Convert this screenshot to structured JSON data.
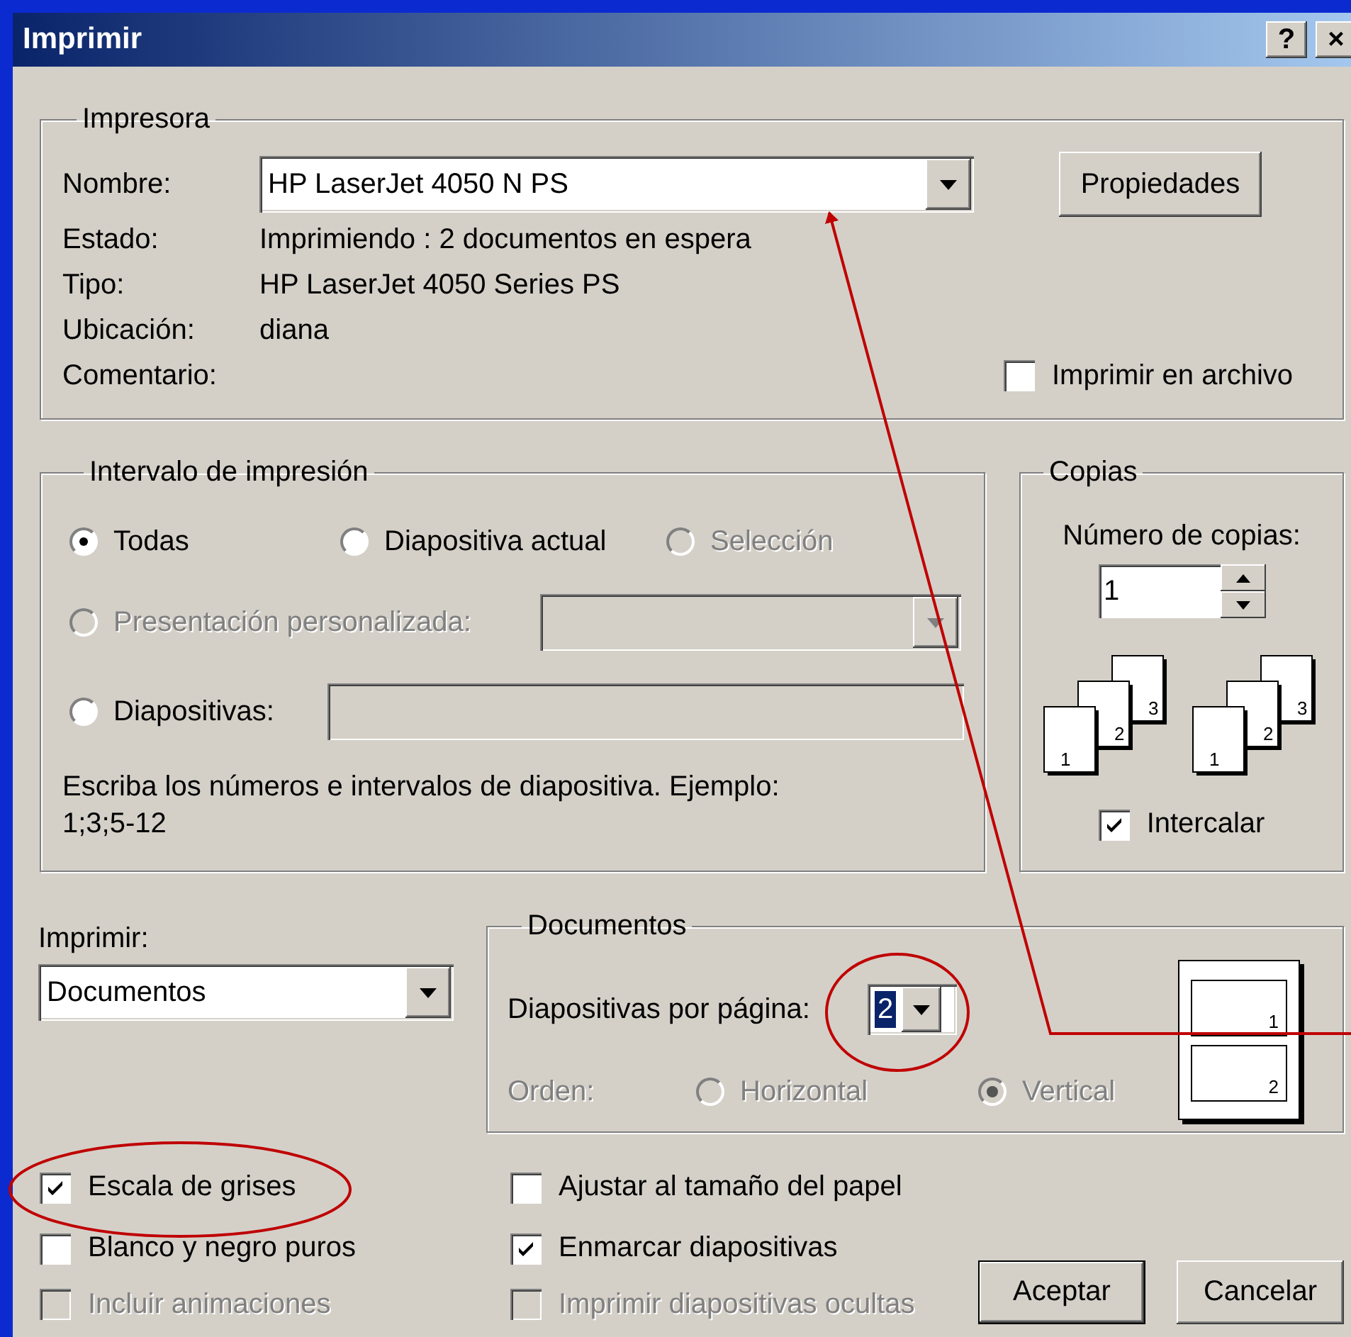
{
  "window": {
    "title": "Imprimir",
    "buttons": [
      "?",
      "×"
    ]
  },
  "printer": {
    "legend": "Impresora",
    "name_label": "Nombre:",
    "name": "HP LaserJet 4050 N PS",
    "properties_button": "Propiedades",
    "info": [
      {
        "label": "Estado:",
        "value": "Imprimiendo : 2 documentos en espera"
      },
      {
        "label": "Tipo:",
        "value": "HP LaserJet 4050 Series PS"
      },
      {
        "label": "Ubicación:",
        "value": "diana"
      },
      {
        "label": "Comentario:"
      }
    ],
    "print_to_file": {
      "label": "Imprimir en archivo",
      "checked": false
    }
  },
  "range": {
    "legend": "Intervalo de impresión",
    "options": [
      {
        "label": "Todas",
        "selected": true,
        "disabled": false
      },
      {
        "label": "Diapositiva actual",
        "selected": false,
        "disabled": false
      },
      {
        "label": "Selección",
        "selected": false,
        "disabled": true
      },
      {
        "label": "Presentación personalizada:",
        "selected": false,
        "disabled": true
      },
      {
        "label": "Diapositivas:",
        "selected": false,
        "disabled": false
      }
    ],
    "hint": "Escriba los números e intervalos de diapositiva. Ejemplo: 1;3;5-12"
  },
  "copies": {
    "legend": "Copias",
    "count_label": "Número de copias:",
    "count": "1",
    "stacks": [
      [
        "1",
        "2",
        "3"
      ],
      [
        "1",
        "2",
        "3"
      ]
    ],
    "collate": {
      "label": "Intercalar",
      "checked": true
    }
  },
  "print_what": {
    "label": "Imprimir:",
    "value": "Documentos"
  },
  "handouts": {
    "legend": "Documentos",
    "per_page_label": "Diapositivas por página:",
    "per_page": "2",
    "order_label": "Orden:",
    "order_disabled": true,
    "order": [
      {
        "label": "Horizontal",
        "selected": false
      },
      {
        "label": "Vertical",
        "selected": true
      }
    ],
    "preview": [
      "1",
      "2"
    ]
  },
  "options": [
    {
      "label": "Escala de grises",
      "checked": true,
      "disabled": false
    },
    {
      "label": "Blanco y negro puros",
      "checked": false,
      "disabled": false
    },
    {
      "label": "Incluir animaciones",
      "checked": false,
      "disabled": true
    },
    {
      "label": "Ajustar al tamaño del papel",
      "checked": false,
      "disabled": false
    },
    {
      "label": "Enmarcar diapositivas",
      "checked": true,
      "disabled": false
    },
    {
      "label": "Imprimir diapositivas ocultas",
      "checked": false,
      "disabled": true
    }
  ],
  "buttons": [
    "Aceptar",
    "Cancelar"
  ]
}
